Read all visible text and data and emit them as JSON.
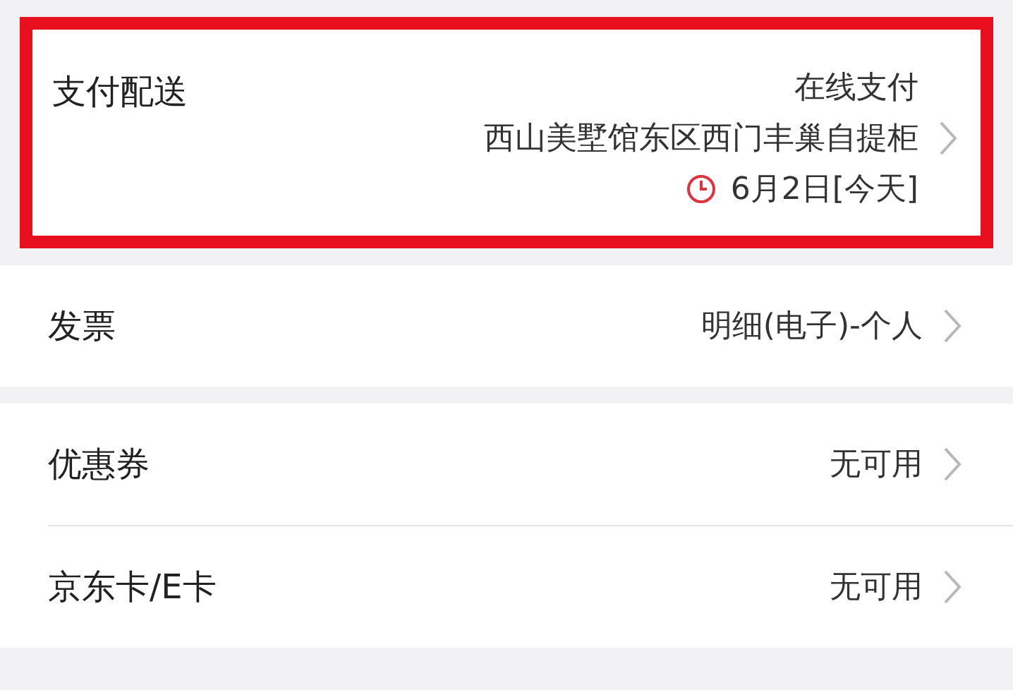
{
  "delivery": {
    "label": "支付配送",
    "highlighted": true,
    "lines": [
      {
        "kind": "text",
        "text": "在线支付"
      },
      {
        "kind": "text",
        "text": "西山美墅馆东区西门丰巢自提柜"
      },
      {
        "kind": "time",
        "text": "6月2日[今天]"
      }
    ]
  },
  "sections": [
    {
      "rows": [
        {
          "label": "发票",
          "value": "明细(电子)-个人"
        }
      ]
    },
    {
      "rows": [
        {
          "label": "优惠券",
          "value": "无可用"
        },
        {
          "label": "京东卡/E卡",
          "value": "无可用"
        }
      ]
    }
  ]
}
